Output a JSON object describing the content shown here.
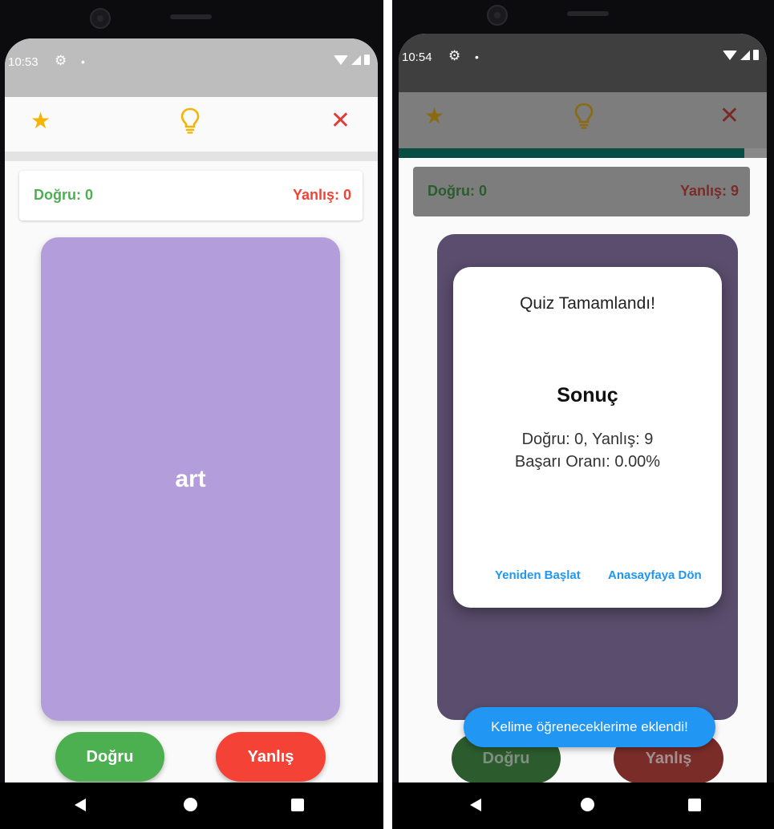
{
  "colors": {
    "correct": "#4caf50",
    "wrong": "#f44336",
    "card": "#b39ddb",
    "progress": "#00695c",
    "accent_blue": "#2196f3",
    "star": "#f5b400"
  },
  "icons": {
    "favorite": "star-icon",
    "hint": "lightbulb-icon",
    "close": "close-icon",
    "settings": "gear-icon",
    "wifi": "wifi-icon",
    "signal": "signal-icon",
    "battery": "battery-icon",
    "back": "back-icon",
    "home": "home-icon",
    "recents": "recents-icon"
  },
  "screen_left": {
    "status": {
      "time": "10:53",
      "dot": "•"
    },
    "score": {
      "correct": "Doğru: 0",
      "wrong": "Yanlış: 0"
    },
    "progress": 0,
    "card_word": "art",
    "buttons": {
      "correct": "Doğru",
      "wrong": "Yanlış"
    }
  },
  "screen_right": {
    "status": {
      "time": "10:54",
      "dot": "•"
    },
    "score": {
      "correct": "Doğru: 0",
      "wrong": "Yanlış: 9"
    },
    "progress": 0.94,
    "buttons": {
      "correct": "Doğru",
      "wrong": "Yanlış"
    },
    "dialog": {
      "title": "Quiz Tamamlandı!",
      "heading": "Sonuç",
      "summary": "Doğru: 0, Yanlış: 9",
      "success_rate": "Başarı Oranı: 0.00%",
      "restart_label": "Yeniden Başlat",
      "home_label": "Anasayfaya Dön"
    },
    "snackbar": "Kelime öğreneceklerime eklendi!"
  }
}
